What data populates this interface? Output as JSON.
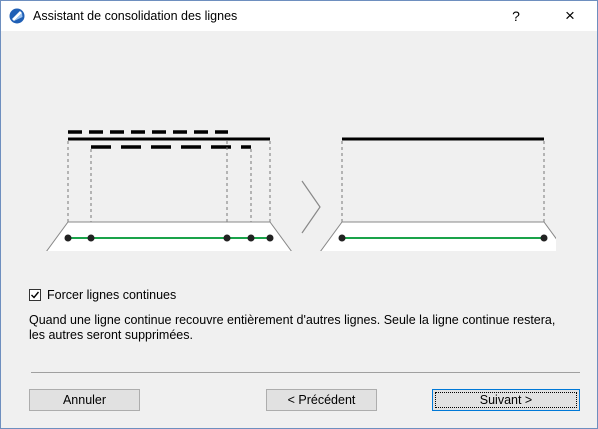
{
  "window": {
    "title": "Assistant de consolidation des lignes",
    "help_label": "?",
    "close_label": "×"
  },
  "colors": {
    "window_border": "#6e8fbf",
    "accent_blue": "#0078d7",
    "line_green": "#1aa34a"
  },
  "icons": {
    "app": "archicad-app-icon",
    "arrow": "chevron-right-icon"
  },
  "option": {
    "checkbox_label": "Forcer lignes continues",
    "checked": true
  },
  "description": "Quand une ligne continue recouvre entièrement d'autres lignes. Seule la ligne continue restera, les autres seront supprimées.",
  "buttons": {
    "cancel": "Annuler",
    "previous": "< Précédent",
    "next": "Suivant >"
  }
}
